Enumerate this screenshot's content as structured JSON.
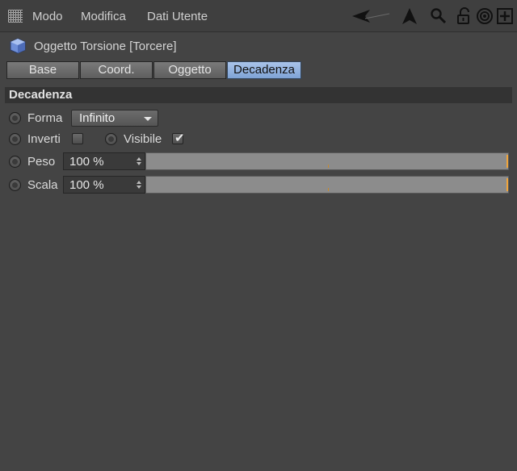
{
  "menubar": {
    "items": [
      "Modo",
      "Modifica",
      "Dati Utente"
    ],
    "tools": [
      "arrow-left-icon",
      "cursor-icon",
      "search-icon",
      "lock-open-icon",
      "target-icon",
      "new-panel-icon"
    ]
  },
  "object": {
    "title": "Oggetto Torsione [Torcere]",
    "icon": "twist-object-icon"
  },
  "tabs": [
    {
      "label": "Base",
      "active": false
    },
    {
      "label": "Coord.",
      "active": false
    },
    {
      "label": "Oggetto",
      "active": false
    },
    {
      "label": "Decadenza",
      "active": true
    }
  ],
  "section": {
    "title": "Decadenza"
  },
  "params": {
    "forma": {
      "label": "Forma",
      "value": "Infinito"
    },
    "inverti": {
      "label": "Inverti",
      "checked": false
    },
    "visibile": {
      "label": "Visibile",
      "checked": true
    },
    "peso": {
      "label": "Peso",
      "value": "100 %",
      "fraction": 1.0
    },
    "scala": {
      "label": "Scala",
      "value": "100 %",
      "fraction": 1.0
    }
  },
  "colors": {
    "accent_tab": "#8fb0e0",
    "slider_mark": "#f0a43a"
  }
}
